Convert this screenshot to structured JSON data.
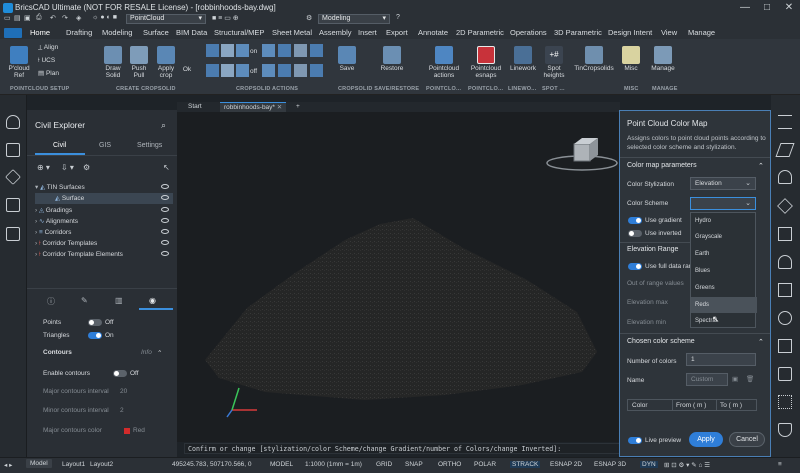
{
  "app": {
    "title": "BricsCAD Ultimate (NOT FOR RESALE License) - [robbinhoods-bay.dwg]",
    "layer_value": "PointCloud",
    "workspace": "Modeling"
  },
  "menu": [
    "Home",
    "Drafting",
    "Modeling",
    "Surface",
    "BIM Data",
    "Structural/MEP",
    "Sheet Metal",
    "Assembly",
    "Insert",
    "Export",
    "Annotate",
    "2D Parametric",
    "Operations",
    "3D Parametric",
    "Design Intent",
    "View",
    "Manage"
  ],
  "ribbon": {
    "small_items": [
      "Align",
      "UCS",
      "Plan"
    ],
    "buttons": [
      {
        "label": "P'cloud Ref"
      },
      {
        "label": "Draw Solid"
      },
      {
        "label": "Push Pull"
      },
      {
        "label": "Apply crop"
      },
      {
        "label": "Ok"
      },
      {
        "label": "on"
      },
      {
        "label": "off"
      },
      {
        "label": "Save"
      },
      {
        "label": "Restore"
      },
      {
        "label": "Pointcloud actions"
      },
      {
        "label": "Pointcloud esnaps"
      },
      {
        "label": "Linework"
      },
      {
        "label": "Spot heights"
      },
      {
        "label": "TinCropsolids"
      },
      {
        "label": "Misc"
      },
      {
        "label": "Manage"
      }
    ],
    "groups": [
      "POINTCLOUD SETUP",
      "CREATE CROPSOLID",
      "CROPSOLID ACTIONS",
      "CROPSOLID SAVE/RESTORE",
      "POINTCLO...",
      "POINTCLO...",
      "LINEWO...",
      "SPOT ...",
      "MISC",
      "MANAGE"
    ]
  },
  "civil": {
    "title": "Civil Explorer",
    "tabs": [
      "Civil",
      "GIS",
      "Settings"
    ],
    "tree": [
      {
        "label": "TIN Surfaces",
        "indent": 0
      },
      {
        "label": "Surface",
        "indent": 1
      },
      {
        "label": "Gradings",
        "indent": 0
      },
      {
        "label": "Alignments",
        "indent": 0
      },
      {
        "label": "Corridors",
        "indent": 0
      },
      {
        "label": "Corridor Templates",
        "indent": 0
      },
      {
        "label": "Corridor Template Elements",
        "indent": 0
      }
    ],
    "props": {
      "points_label": "Points",
      "points_state": "Off",
      "triangles_label": "Triangles",
      "triangles_state": "On",
      "contours_label": "Contours",
      "contours_info": "Info",
      "enable_contours_label": "Enable contours",
      "enable_contours_state": "Off",
      "major_interval_label": "Major contours interval",
      "major_interval_value": "20",
      "minor_interval_label": "Minor contours interval",
      "minor_interval_value": "2",
      "major_color_label": "Major contours color",
      "major_color_value": "Red"
    }
  },
  "drawing_tabs": [
    "Start",
    "robbinhoods-bay*"
  ],
  "command_line": "Confirm or change [stylization/color Scheme/change Gradient/number of Colors/change Inverted]:",
  "pc_panel": {
    "title": "Point Cloud Color Map",
    "description": "Assigns colors to point cloud points according to selected color scheme and stylization.",
    "section_params": "Color map parameters",
    "stylization_label": "Color Stylization",
    "stylization_value": "Elevation",
    "scheme_label": "Color Scheme",
    "use_gradient": "Use gradient",
    "use_inverted": "Use inverted",
    "elev_range": "Elevation Range",
    "use_full_data": "Use full data ran",
    "out_of_range": "Out of range values",
    "elev_max": "Elevation max",
    "elev_min": "Elevation min",
    "scheme_options": [
      "Hydro",
      "Grayscale",
      "Earth",
      "Blues",
      "Greens",
      "Reds",
      "Spectral"
    ],
    "section_chosen": "Chosen color scheme",
    "num_colors_label": "Number of colors",
    "num_colors_value": "1",
    "name_label": "Name",
    "name_value": "Custom",
    "table_headers": [
      "Color",
      "From ( m )",
      "To ( m )"
    ],
    "live_preview": "Live preview",
    "apply": "Apply",
    "cancel": "Cancel"
  },
  "status": {
    "layouts": [
      "Model",
      "Layout1",
      "Layout2"
    ],
    "coords": "495245.783, 507170.566, 0",
    "items": [
      "MODEL",
      "1:1000 (1mm = 1m)",
      "GRID",
      "SNAP",
      "ORTHO",
      "POLAR",
      "STRACK",
      "ESNAP 2D",
      "ESNAP 3D",
      "DYN"
    ]
  },
  "colors": {
    "accent": "#2f7ed8",
    "panel_border": "#4a7fb5",
    "major_color_swatch": "#d22b2b"
  }
}
